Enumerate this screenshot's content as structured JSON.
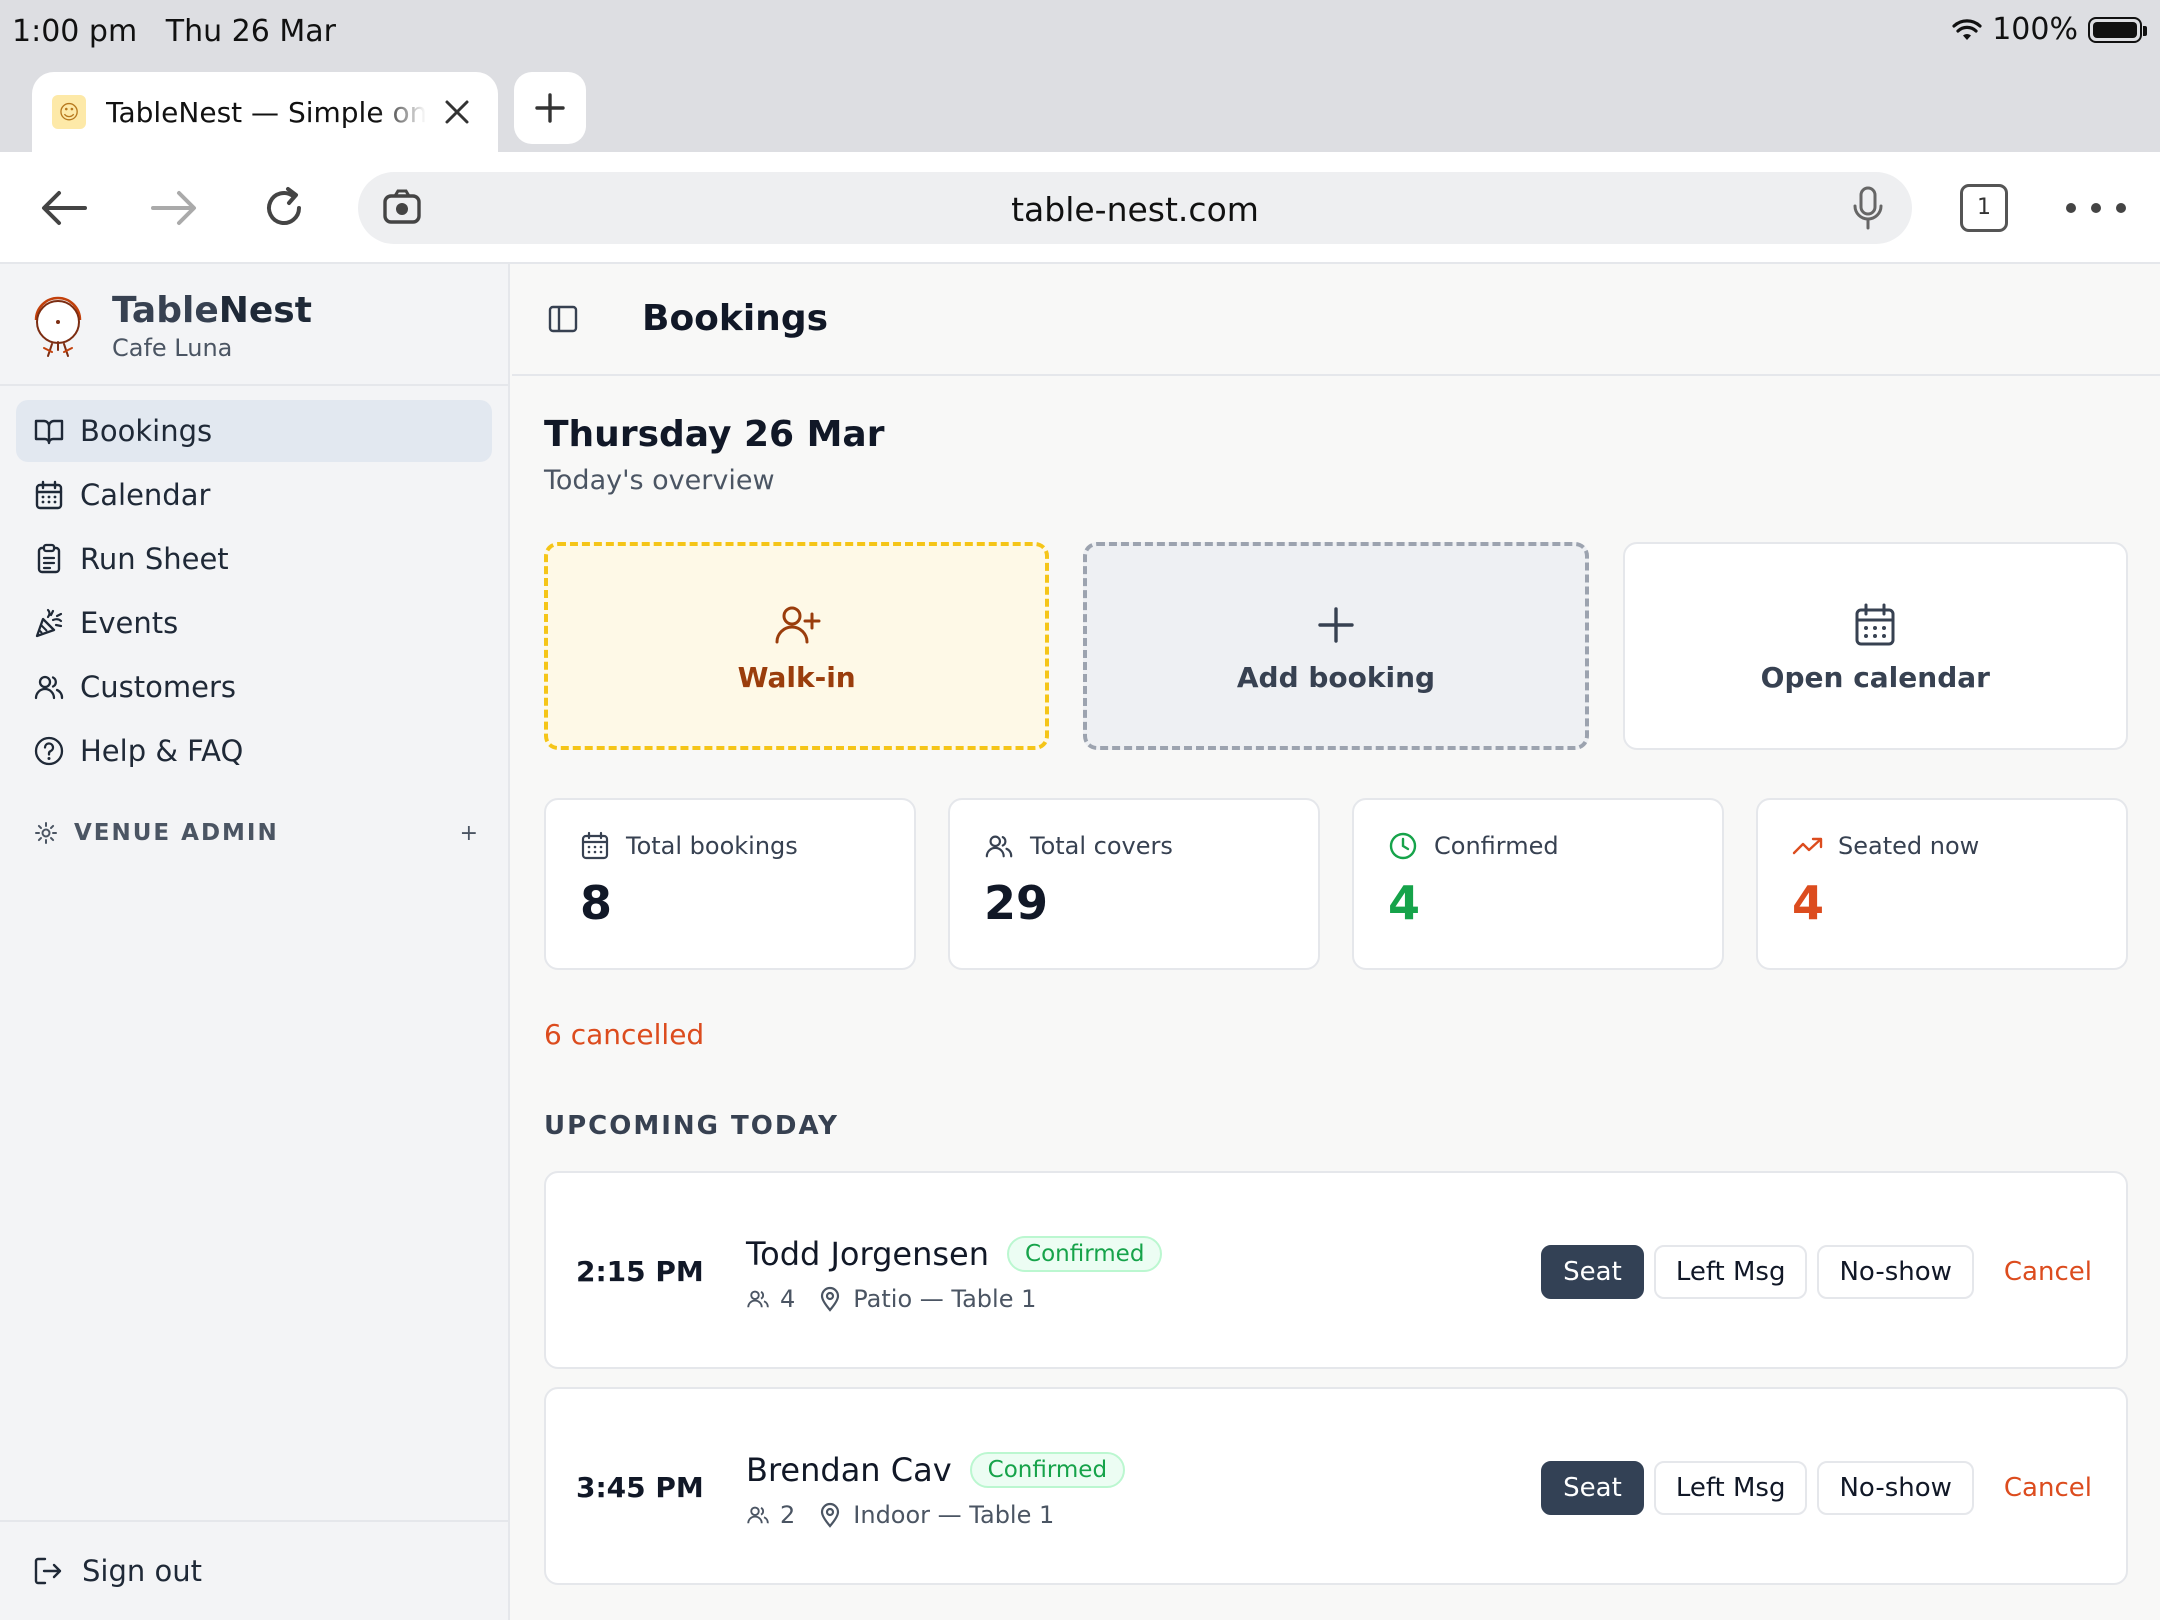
{
  "status_bar": {
    "time": "1:00 pm",
    "date": "Thu 26 Mar",
    "battery": "100%"
  },
  "browser": {
    "tab_title": "TableNest — Simple online",
    "url": "table-nest.com",
    "tab_count": "1"
  },
  "sidebar": {
    "brand_name_part1": "Table",
    "brand_name_part2": "Nest",
    "venue": "Cafe Luna",
    "items": [
      {
        "label": "Bookings",
        "icon": "book-open-icon",
        "active": true
      },
      {
        "label": "Calendar",
        "icon": "calendar-icon"
      },
      {
        "label": "Run Sheet",
        "icon": "clipboard-icon"
      },
      {
        "label": "Events",
        "icon": "party-popper-icon"
      },
      {
        "label": "Customers",
        "icon": "users-icon"
      },
      {
        "label": "Help & FAQ",
        "icon": "help-circle-icon"
      }
    ],
    "admin_label": "VENUE ADMIN",
    "signout_label": "Sign out"
  },
  "header": {
    "title": "Bookings"
  },
  "overview": {
    "date_heading": "Thursday 26 Mar",
    "subtitle": "Today's overview"
  },
  "actions": {
    "walk_in": "Walk-in",
    "add_booking": "Add booking",
    "open_calendar": "Open calendar"
  },
  "stats": {
    "total_bookings": {
      "label": "Total bookings",
      "value": "8"
    },
    "total_covers": {
      "label": "Total covers",
      "value": "29"
    },
    "confirmed": {
      "label": "Confirmed",
      "value": "4",
      "color": "#16a34a"
    },
    "seated_now": {
      "label": "Seated now",
      "value": "4",
      "color": "#dc4c1e"
    }
  },
  "cancelled_text": "6 cancelled",
  "upcoming": {
    "heading": "UPCOMING TODAY",
    "bookings": [
      {
        "time": "2:15 PM",
        "name": "Todd Jorgensen",
        "status": "Confirmed",
        "covers": "4",
        "location": "Patio — Table 1"
      },
      {
        "time": "3:45 PM",
        "name": "Brendan Cav",
        "status": "Confirmed",
        "covers": "2",
        "location": "Indoor — Table 1"
      }
    ],
    "buttons": {
      "seat": "Seat",
      "left_msg": "Left Msg",
      "no_show": "No-show",
      "cancel": "Cancel"
    }
  }
}
